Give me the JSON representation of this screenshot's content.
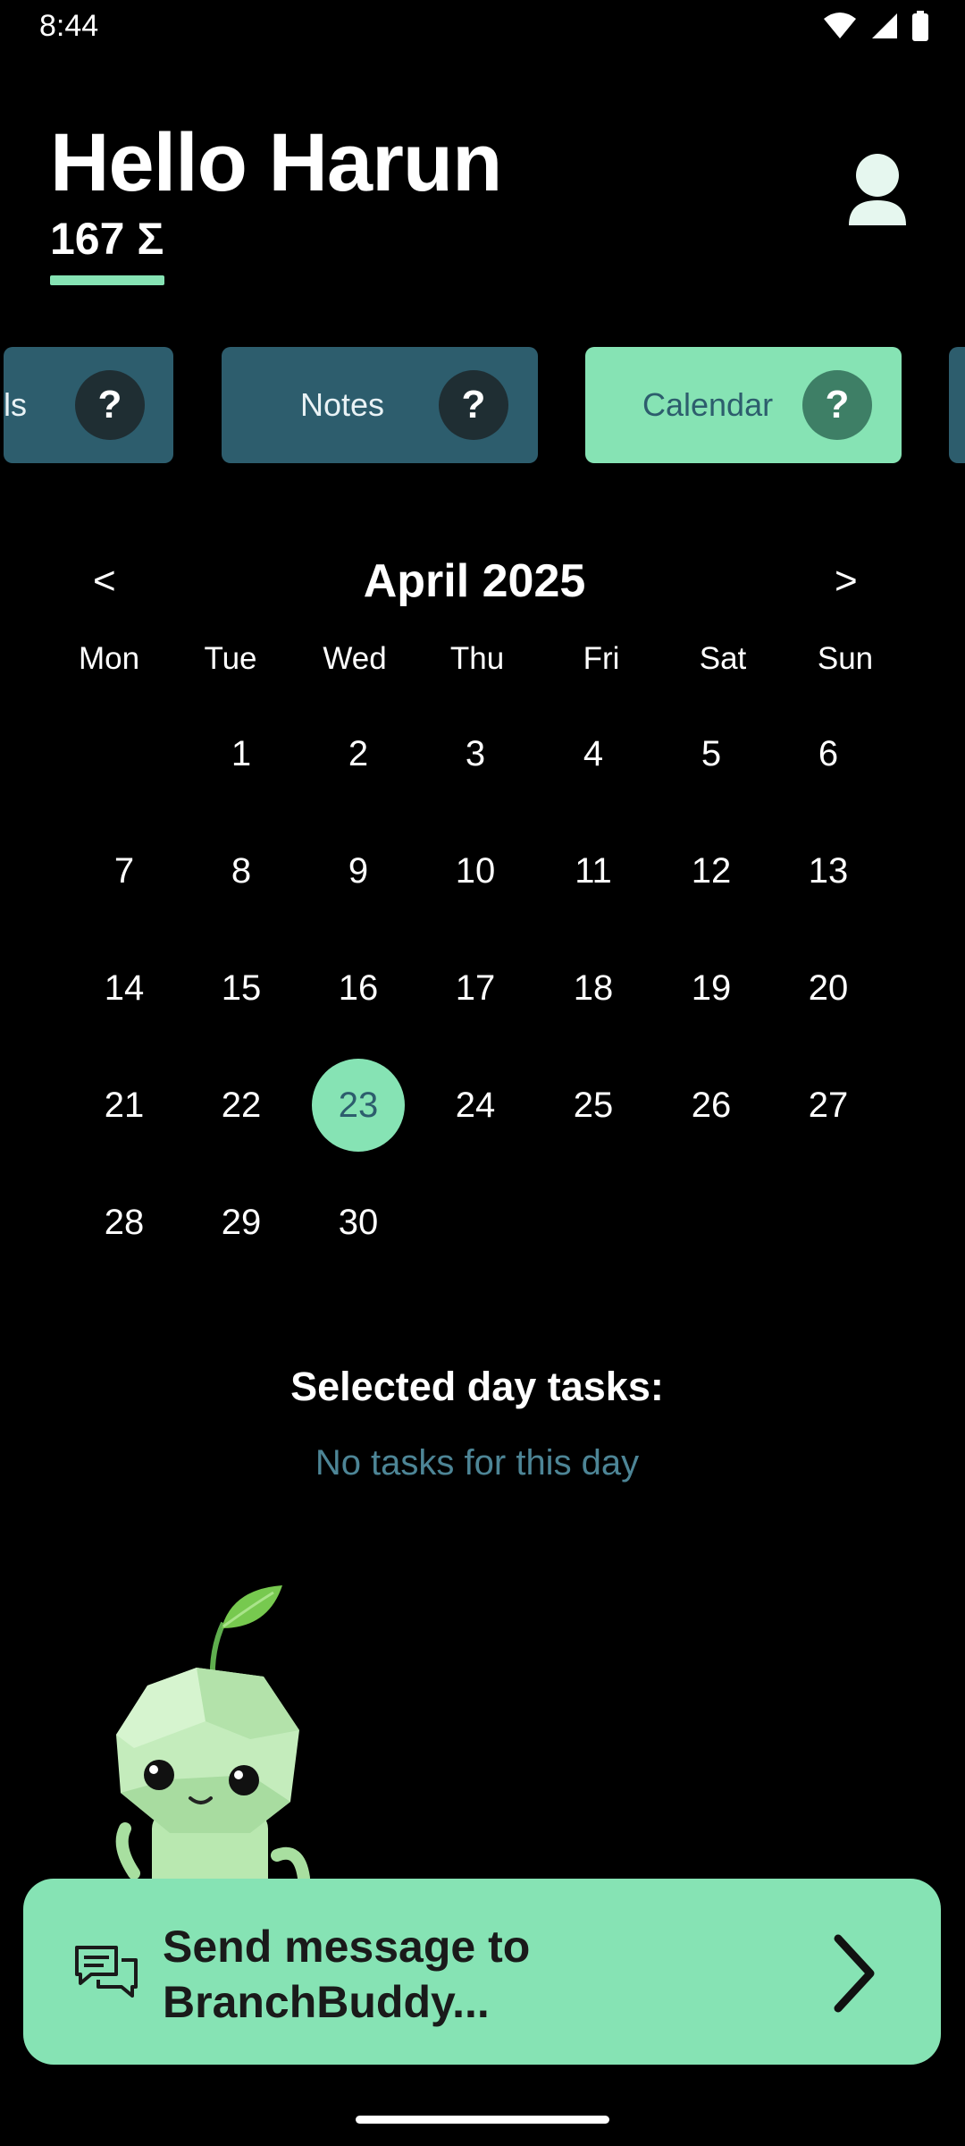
{
  "status_bar": {
    "time": "8:44"
  },
  "header": {
    "greeting": "Hello Harun",
    "score": "167 Σ"
  },
  "tabs": [
    {
      "label": "ls",
      "help": "?"
    },
    {
      "label": "Notes",
      "help": "?"
    },
    {
      "label": "Calendar",
      "help": "?",
      "active": true
    }
  ],
  "calendar": {
    "prev": "<",
    "next": ">",
    "month_title": "April 2025",
    "weekdays": [
      "Mon",
      "Tue",
      "Wed",
      "Thu",
      "Fri",
      "Sat",
      "Sun"
    ],
    "days": [
      "1",
      "2",
      "3",
      "4",
      "5",
      "6",
      "7",
      "8",
      "9",
      "10",
      "11",
      "12",
      "13",
      "14",
      "15",
      "16",
      "17",
      "18",
      "19",
      "20",
      "21",
      "22",
      "23",
      "24",
      "25",
      "26",
      "27",
      "28",
      "29",
      "30"
    ],
    "selected_day": "23"
  },
  "tasks": {
    "title": "Selected day tasks:",
    "empty_message": "No tasks for this day"
  },
  "message_bar": {
    "line1": "Send message to",
    "line2": "BranchBuddy..."
  },
  "colors": {
    "accent": "#86e3b4",
    "tab_dark": "#2d5d6d",
    "muted_text": "#4d8596",
    "background": "#000000"
  }
}
